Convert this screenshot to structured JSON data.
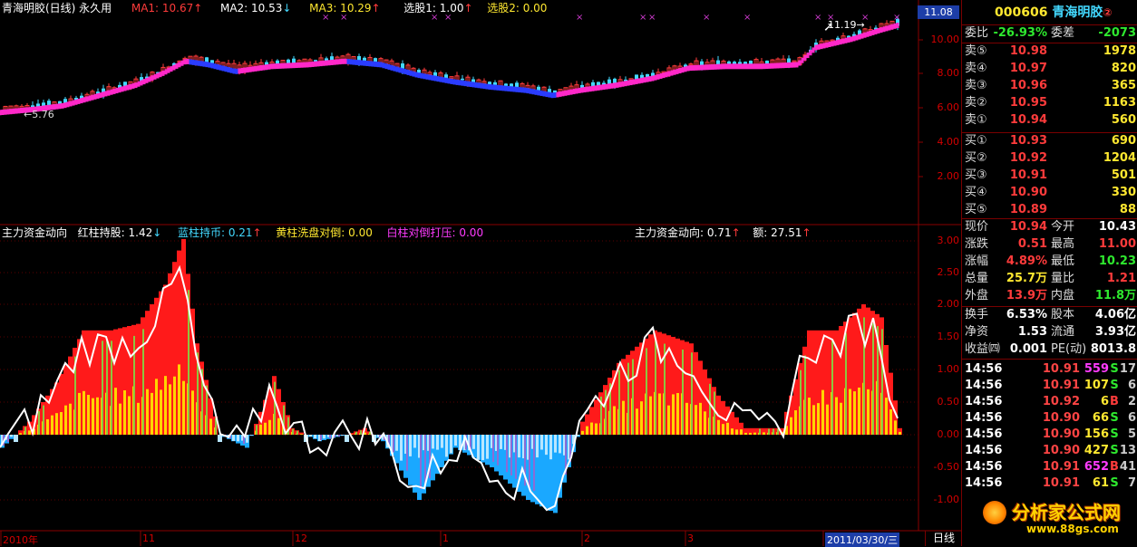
{
  "main_header": {
    "title": "青海明胶(日线) 永久用",
    "ma1_label": "MA1: 10.67",
    "ma1_arrow": "↑",
    "ma2_label": "MA2: 10.53",
    "ma2_arrow": "↓",
    "ma3_label": "MA3: 10.29",
    "ma3_arrow": "↑",
    "pick1_label": "选股1: 1.00",
    "pick1_arrow": "↑",
    "pick2_label": "选股2: 0.00"
  },
  "main_chart": {
    "price_axis": [
      "10.00",
      "8.00",
      "6.00",
      "4.00",
      "2.00"
    ],
    "current_price_tag": "11.08",
    "low_marker": "←5.76",
    "high_marker": "11.19→",
    "colors": {
      "up": "#ff3b3b",
      "down": "#43d9ff",
      "ma_pink": "#ff28c8",
      "ma_blue": "#2a3cff",
      "marker": "#d03bd0"
    }
  },
  "indicator_header": {
    "name": "主力资金动向",
    "red_label": "红柱持股: 1.42",
    "red_arrow": "↓",
    "blue_label": "蓝柱持币: 0.21",
    "blue_arrow": "↑",
    "yellow_label": "黄柱洗盘对倒: 0.00",
    "white_label": "白柱对倒打压: 0.00",
    "right_name": "主力资金动向: 0.71",
    "right_arrow": "↑",
    "amount_label": "额: 27.51",
    "amount_arrow": "↑"
  },
  "indicator_axis": [
    "3.00",
    "2.50",
    "2.00",
    "1.50",
    "1.00",
    "0.50",
    "0.00",
    "-0.50",
    "-1.00"
  ],
  "date_axis": [
    {
      "label": "2010年",
      "highlight": false
    },
    {
      "label": "11",
      "highlight": false
    },
    {
      "label": "12",
      "highlight": false
    },
    {
      "label": "1",
      "highlight": false
    },
    {
      "label": "2",
      "highlight": false
    },
    {
      "label": "3",
      "highlight": false
    },
    {
      "label": "2011/03/30/三",
      "highlight": true
    }
  ],
  "period_tab": "日线",
  "quote": {
    "code": "000606",
    "name": "青海明胶",
    "badge": "②",
    "weibi_label": "委比",
    "weibi_value": "-26.93%",
    "weicha_label": "委差",
    "weicha_value": "-2073",
    "asks": [
      {
        "label": "卖⑤",
        "price": "10.98",
        "vol": "1978"
      },
      {
        "label": "卖④",
        "price": "10.97",
        "vol": "820"
      },
      {
        "label": "卖③",
        "price": "10.96",
        "vol": "365"
      },
      {
        "label": "卖②",
        "price": "10.95",
        "vol": "1163"
      },
      {
        "label": "卖①",
        "price": "10.94",
        "vol": "560"
      }
    ],
    "bids": [
      {
        "label": "买①",
        "price": "10.93",
        "vol": "690"
      },
      {
        "label": "买②",
        "price": "10.92",
        "vol": "1204"
      },
      {
        "label": "买③",
        "price": "10.91",
        "vol": "501"
      },
      {
        "label": "买④",
        "price": "10.90",
        "vol": "330"
      },
      {
        "label": "买⑤",
        "price": "10.89",
        "vol": "88"
      }
    ],
    "stats": [
      {
        "l1": "现价",
        "v1": "10.94",
        "c1": "red",
        "l2": "今开",
        "v2": "10.43",
        "c2": "white"
      },
      {
        "l1": "涨跌",
        "v1": "0.51",
        "c1": "red",
        "l2": "最高",
        "v2": "11.00",
        "c2": "red"
      },
      {
        "l1": "涨幅",
        "v1": "4.89%",
        "c1": "red",
        "l2": "最低",
        "v2": "10.23",
        "c2": "green"
      },
      {
        "l1": "总量",
        "v1": "25.7万",
        "c1": "yellow",
        "l2": "量比",
        "v2": "1.21",
        "c2": "red"
      },
      {
        "l1": "外盘",
        "v1": "13.9万",
        "c1": "red",
        "l2": "内盘",
        "v2": "11.8万",
        "c2": "green"
      }
    ],
    "fund": [
      {
        "l1": "换手",
        "v1": "6.53%",
        "l2": "股本",
        "v2": "4.06亿"
      },
      {
        "l1": "净资",
        "v1": "1.53",
        "l2": "流通",
        "v2": "3.93亿"
      },
      {
        "l1": "收益㈣",
        "v1": "0.001",
        "l2": "PE(动)",
        "v2": "8013.8"
      }
    ],
    "ticks": [
      {
        "time": "14:56",
        "price": "10.91",
        "vol": "559",
        "side": "S",
        "n": "17",
        "vc": "magenta"
      },
      {
        "time": "14:56",
        "price": "10.91",
        "vol": "107",
        "side": "S",
        "n": "6",
        "vc": "yellow"
      },
      {
        "time": "14:56",
        "price": "10.92",
        "vol": "6",
        "side": "B",
        "n": "2",
        "vc": "yellow"
      },
      {
        "time": "14:56",
        "price": "10.90",
        "vol": "66",
        "side": "S",
        "n": "6",
        "vc": "yellow"
      },
      {
        "time": "14:56",
        "price": "10.90",
        "vol": "156",
        "side": "S",
        "n": "5",
        "vc": "yellow"
      },
      {
        "time": "14:56",
        "price": "10.90",
        "vol": "427",
        "side": "S",
        "n": "13",
        "vc": "yellow"
      },
      {
        "time": "14:56",
        "price": "10.91",
        "vol": "652",
        "side": "B",
        "n": "41",
        "vc": "magenta"
      },
      {
        "time": "14:56",
        "price": "10.91",
        "vol": "61",
        "side": "S",
        "n": "7",
        "vc": "yellow"
      }
    ]
  },
  "watermark": {
    "title": "分析家公式网",
    "url": "www.88gs.com"
  }
}
